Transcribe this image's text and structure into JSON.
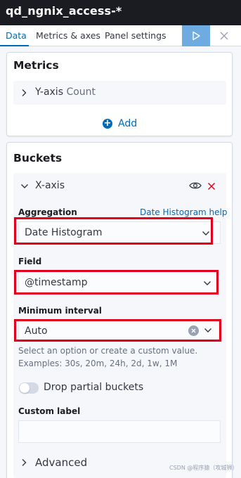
{
  "header": {
    "title": "qd_ngnix_access-*"
  },
  "tabs": [
    {
      "label": "Data",
      "active": true
    },
    {
      "label": "Metrics & axes",
      "active": false
    },
    {
      "label": "Panel settings",
      "active": false
    }
  ],
  "metrics": {
    "title": "Metrics",
    "yaxis": {
      "name": "Y-axis",
      "aggregation": "Count"
    },
    "add_label": "Add"
  },
  "buckets": {
    "title": "Buckets",
    "xaxis": {
      "name": "X-axis",
      "aggregation_label": "Aggregation",
      "help_link": "Date Histogram help",
      "aggregation_value": "Date Histogram",
      "field_label": "Field",
      "field_value": "@timestamp",
      "interval_label": "Minimum interval",
      "interval_value": "Auto",
      "interval_help": [
        "Select an option or create a custom value.",
        "Examples: 30s, 20m, 24h, 2d, 1w, 1M"
      ],
      "drop_partial_label": "Drop partial buckets",
      "drop_partial_enabled": false,
      "custom_label": "Custom label",
      "custom_label_value": "",
      "advanced_label": "Advanced"
    }
  },
  "watermark": "CSDN @程序猿（攻城狮）",
  "colors": {
    "accent": "#006bb8",
    "highlight": "#e0001b",
    "play_button": "#6dabe0",
    "titlebar": "#1a1c21"
  },
  "icons": {
    "play": "play-icon",
    "close": "close-icon",
    "chevron_right": "chevron-right-icon",
    "chevron_down": "chevron-down-icon",
    "add": "plus-circle-icon",
    "eye": "eye-icon",
    "remove": "cross-icon",
    "clear": "clear-icon"
  }
}
